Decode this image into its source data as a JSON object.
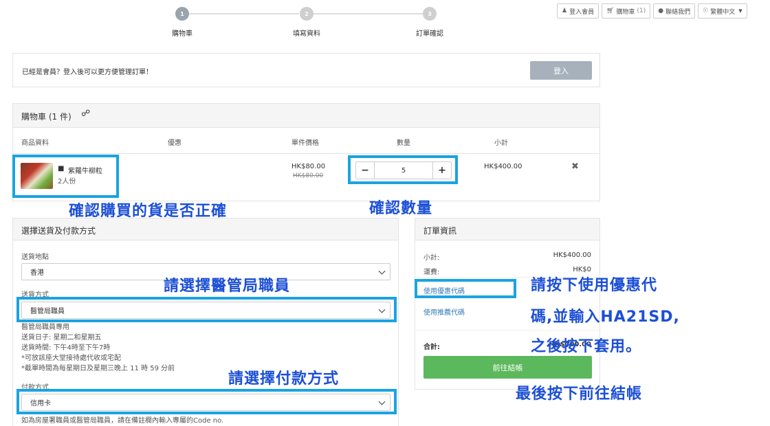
{
  "topnav": {
    "login": "登入會員",
    "cart": "購物車",
    "cart_count": "(1)",
    "contact": "聯絡我們",
    "language": "繁體中文"
  },
  "steps": [
    {
      "num": "1",
      "label": "購物車"
    },
    {
      "num": "2",
      "label": "填寫資料"
    },
    {
      "num": "3",
      "label": "訂單確認"
    }
  ],
  "member": {
    "prompt": "已經是會員？登入後可以更方便管理訂單！",
    "login_button": "登入"
  },
  "cart": {
    "title": "購物車 (1 件)",
    "headers": {
      "product": "商品資料",
      "discount": "優惠",
      "unit_price": "單件價格",
      "quantity": "數量",
      "subtotal": "小計"
    },
    "item": {
      "name": "紫羅牛柳粒",
      "spec": "2人份",
      "price": "HK$80.00",
      "original_price": "HK$80.00",
      "quantity": "5",
      "subtotal": "HK$400.00"
    }
  },
  "delivery": {
    "title": "選擇送貨及付款方式",
    "region_label": "送貨地點",
    "region_value": "香港",
    "method_label": "送貨方式",
    "method_value": "醫管局職員",
    "notes": [
      "醫管局職員專用",
      "送貨日子: 星期二和星期五",
      "送貨時間: 下午4時至下午7時",
      "*可放該座大堂接待處代收或宅配",
      "*截單時間為每星期日及星期三晚上 11 時 59 分前"
    ],
    "payment_label": "付款方式",
    "payment_value": "信用卡",
    "payment_note": "如為房屋署職員或醫管局職員，請在備註欄內輸入專屬的Code no."
  },
  "order": {
    "title": "訂單資訊",
    "subtotal_label": "小計:",
    "subtotal_value": "HK$400.00",
    "shipping_label": "運費:",
    "shipping_value": "HK$0",
    "coupon_link": "使用優惠代碼",
    "referral_link": "使用推薦代碼",
    "total_label": "合計:",
    "total_value": "HK$400.00",
    "checkout_button": "前往結帳"
  },
  "annotations": {
    "check_goods": "確認購買的貨是否正確",
    "check_qty": "確認數量",
    "select_staff": "請選擇醫管局職員",
    "coupon_1": "請按下使用優惠代",
    "coupon_2": "碼,並輸入HA21SD,",
    "coupon_3": "之後按下套用。",
    "select_payment": "請選擇付款方式",
    "final": "最後按下前往結帳"
  },
  "colors": {
    "highlight": "#1aa3e0",
    "annotation": "#1c4fd6",
    "checkout": "#5cb85c",
    "login_button": "#a7b1bb"
  }
}
